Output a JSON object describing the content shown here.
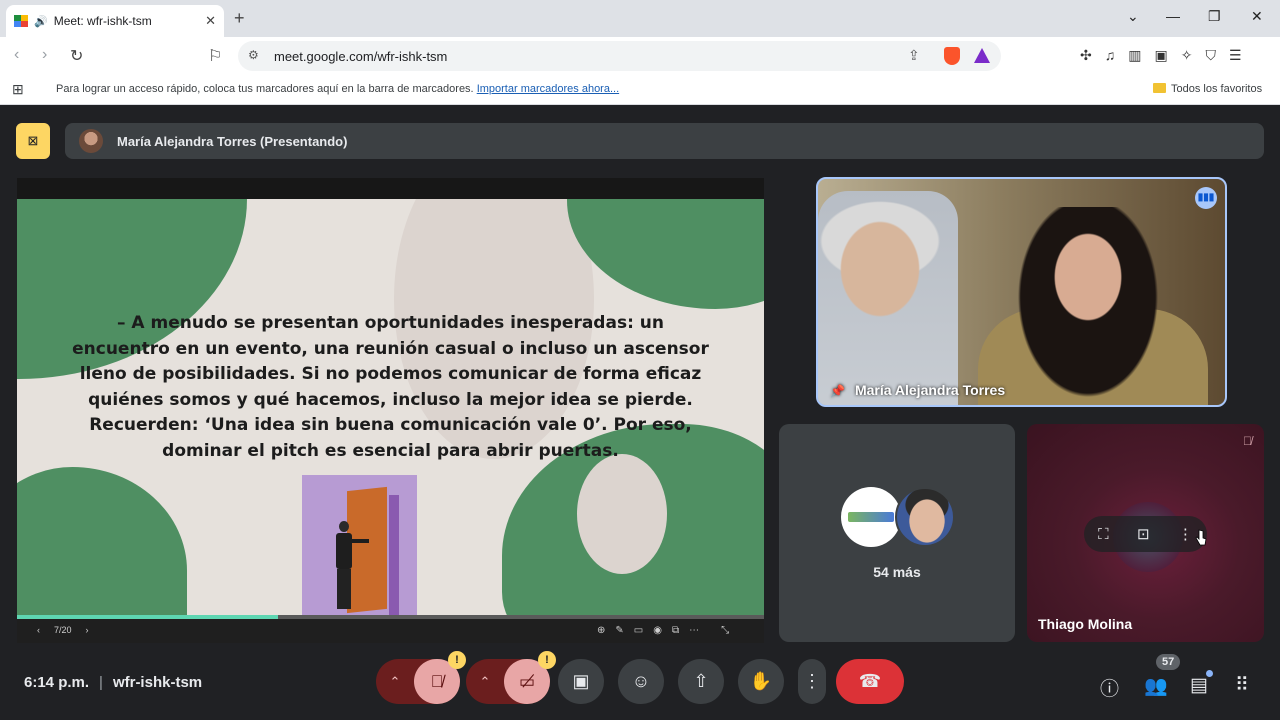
{
  "browser": {
    "tab_title": "Meet: wfr-ishk-tsm",
    "new_tab": "+",
    "url": "meet.google.com/wfr-ishk-tsm",
    "bookmarks_message": "Para lograr un acceso rápido, coloca tus marcadores aquí en la barra de marcadores.",
    "bookmarks_import": "Importar marcadores ahora...",
    "all_bookmarks": "Todos los favoritos"
  },
  "meet": {
    "presenter_bar": "María Alejandra Torres (Presentando)",
    "slide": {
      "text": "– A menudo se presentan oportunidades inesperadas: un encuentro en un evento, una reunión casual o incluso un ascensor lleno de posibilidades. Si no podemos comunicar de forma eficaz quiénes somos y qué hacemos, incluso la mejor idea se pierde. Recuerden: ‘Una idea sin buena comunicación vale 0’. Por eso, dominar el pitch es esencial para abrir puertas.",
      "page": "7/20",
      "progress": 0.35
    },
    "tiles": {
      "main_name": "María Alejandra Torres",
      "more_label": "54 más",
      "thiago_name": "Thiago Molina"
    },
    "bottom": {
      "time": "6:14 p.m.",
      "separator": "|",
      "code": "wfr-ishk-tsm",
      "participants_count": "57"
    }
  },
  "colors": {
    "slide_green": "#4f8f62",
    "slide_bg": "#e6e1dc",
    "hangup": "#dc3237",
    "presenting": "#fdd663"
  },
  "icons": {
    "mic": "mic-off-icon",
    "cam": "camera-off-icon",
    "captions": "captions-icon",
    "emoji": "emoji-icon",
    "present": "present-icon",
    "hand": "raise-hand-icon",
    "more": "more-options-icon",
    "hangup": "hangup-icon"
  }
}
